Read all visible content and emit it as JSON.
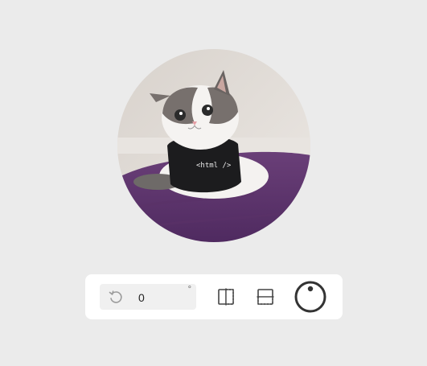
{
  "avatar": {
    "icon": "cat-photo",
    "shirt_text": "<html />"
  },
  "toolbar": {
    "rotate": {
      "icon": "rotate-left-icon",
      "value": "0",
      "unit": "°"
    },
    "flip_horizontal": {
      "icon": "flip-horizontal-icon"
    },
    "flip_vertical": {
      "icon": "flip-vertical-icon"
    },
    "dial": {
      "icon": "rotation-dial-icon"
    }
  }
}
